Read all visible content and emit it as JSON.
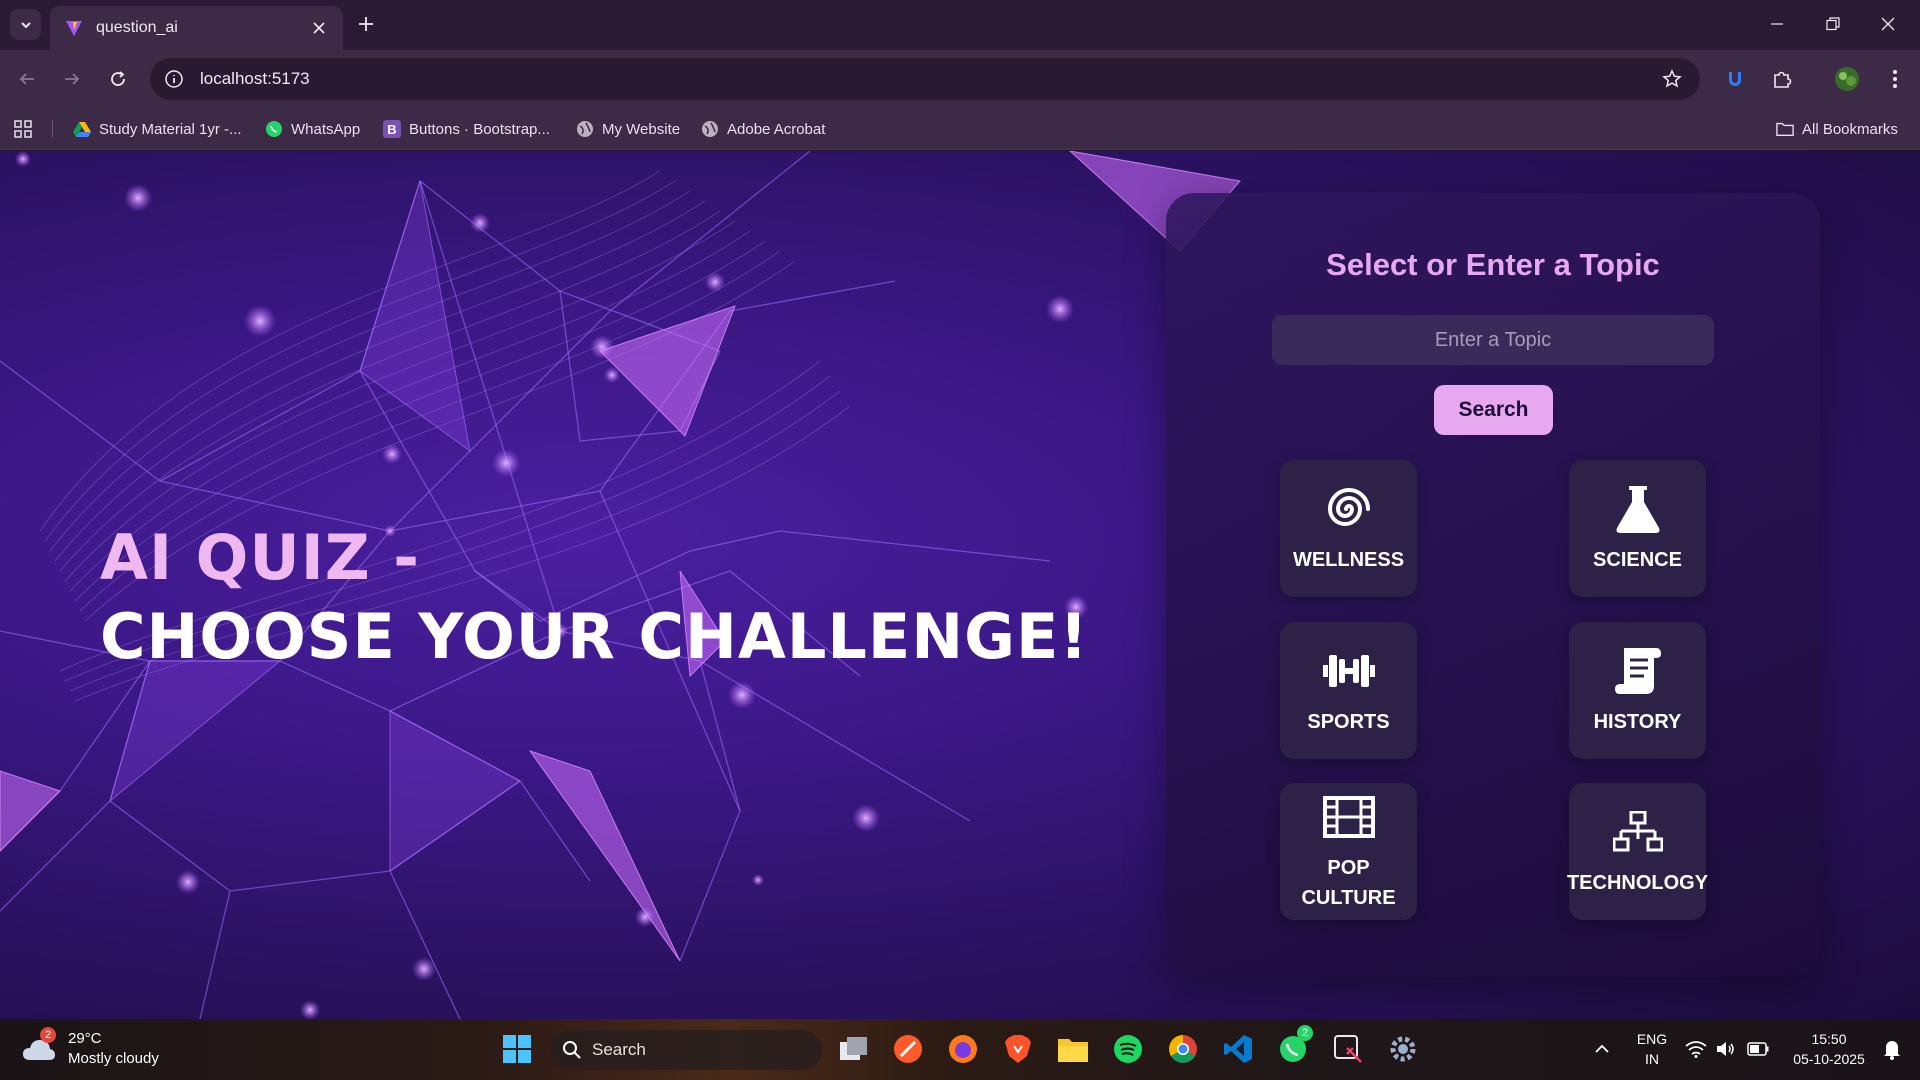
{
  "browser": {
    "tab_title": "question_ai",
    "url": "localhost:5173",
    "bookmarks": [
      {
        "label": "Study Material 1yr -...",
        "icon": "google-drive-icon"
      },
      {
        "label": "WhatsApp",
        "icon": "whatsapp-icon"
      },
      {
        "label": "Buttons · Bootstrap...",
        "icon": "bootstrap-icon"
      },
      {
        "label": "My Website",
        "icon": "globe-icon"
      },
      {
        "label": "Adobe Acrobat",
        "icon": "globe-icon"
      }
    ],
    "all_bookmarks_label": "All Bookmarks"
  },
  "hero": {
    "line1": "AI QUIZ -",
    "line2": "CHOOSE YOUR CHALLENGE!"
  },
  "panel": {
    "title": "Select or Enter a Topic",
    "input_placeholder": "Enter a Topic",
    "input_value": "",
    "search_label": "Search",
    "topics": [
      {
        "label": "WELLNESS",
        "icon": "spiral-icon"
      },
      {
        "label": "SCIENCE",
        "icon": "flask-icon"
      },
      {
        "label": "SPORTS",
        "icon": "dumbbell-icon"
      },
      {
        "label": "HISTORY",
        "icon": "scroll-icon"
      },
      {
        "label": "POP CULTURE",
        "icon": "film-icon"
      },
      {
        "label": "TECHNOLOGY",
        "icon": "network-icon"
      }
    ]
  },
  "taskbar": {
    "weather_badge": "2",
    "temperature": "29°C",
    "condition": "Mostly cloudy",
    "search_label": "Search",
    "whatsapp_badge": "2",
    "lang_line1": "ENG",
    "lang_line2": "IN",
    "time": "15:50",
    "date": "05-10-2025"
  },
  "colors": {
    "accent_pink": "#e8a8f0",
    "hero_line1": "#f0b8f0",
    "panel_bg": "#2a1550",
    "card_bg": "#2e2148"
  }
}
